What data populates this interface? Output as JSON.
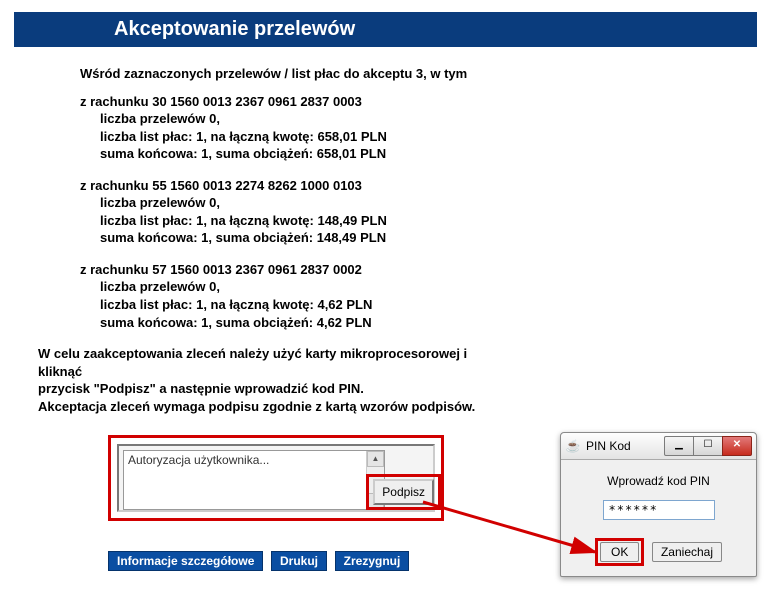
{
  "header": {
    "title": "Akceptowanie przelewów"
  },
  "intro": "Wśród zaznaczonych przelewów / list płac do akceptu 3, w tym",
  "accounts": [
    {
      "header": "z rachunku 30 1560 0013 2367 0961 2837 0003",
      "line1": "liczba przelewów 0,",
      "line2": "liczba list płac: 1, na łączną kwotę: 658,01 PLN",
      "line3": "suma końcowa: 1, suma obciążeń: 658,01 PLN"
    },
    {
      "header": "z rachunku 55 1560 0013 2274 8262 1000 0103",
      "line1": "liczba przelewów 0,",
      "line2": "liczba list płac: 1, na łączną kwotę: 148,49 PLN",
      "line3": "suma końcowa: 1, suma obciążeń: 148,49 PLN"
    },
    {
      "header": "z rachunku 57 1560 0013 2367 0961 2837 0002",
      "line1": "liczba przelewów 0,",
      "line2": "liczba list płac: 1, na łączną kwotę: 4,62 PLN",
      "line3": "suma końcowa: 1, suma obciążeń: 4,62 PLN"
    }
  ],
  "instructions": {
    "l1": "W celu zaakceptowania zleceń należy użyć karty mikroprocesorowej i kliknąć",
    "l2": "przycisk \"Podpisz\" a następnie wprowadzić kod PIN.",
    "l3": "Akceptacja zleceń wymaga podpisu zgodnie z kartą wzorów podpisów."
  },
  "authBox": {
    "text": "Autoryzacja użytkownika...",
    "signLabel": "Podpisz"
  },
  "bottomButtons": {
    "details": "Informacje szczegółowe",
    "print": "Drukuj",
    "cancel": "Zrezygnuj"
  },
  "pinDialog": {
    "javaGlyph": "☕",
    "title": "PIN Kod",
    "minGlyph": "▁",
    "maxGlyph": "☐",
    "closeGlyph": "✕",
    "prompt": "Wprowadź kod PIN",
    "value": "******",
    "ok": "OK",
    "cancel": "Zaniechaj"
  },
  "scroll": {
    "up": "▲",
    "down": "▼"
  }
}
